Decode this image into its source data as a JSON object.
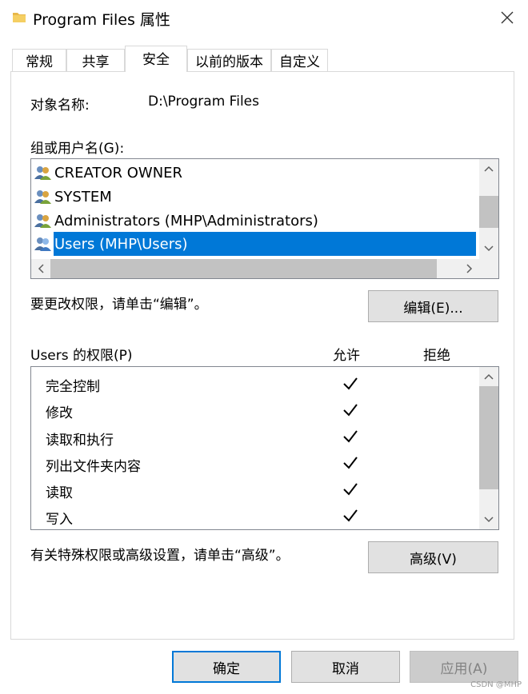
{
  "window": {
    "title": "Program Files 属性",
    "icon": "folder-icon"
  },
  "tabs": [
    {
      "label": "常规"
    },
    {
      "label": "共享"
    },
    {
      "label": "安全",
      "active": true
    },
    {
      "label": "以前的版本"
    },
    {
      "label": "自定义"
    }
  ],
  "security": {
    "object_name_label": "对象名称:",
    "object_name_value": "D:\\Program Files",
    "groups_label": "组或用户名(G):",
    "groups": [
      {
        "name": "CREATOR OWNER",
        "icon": "user-group-icon"
      },
      {
        "name": "SYSTEM",
        "icon": "user-group-icon"
      },
      {
        "name": "Administrators (MHP\\Administrators)",
        "icon": "user-group-icon"
      },
      {
        "name": "Users (MHP\\Users)",
        "icon": "user-group-icon",
        "selected": true
      }
    ],
    "edit_hint": "要更改权限，请单击“编辑”。",
    "edit_button": "编辑(E)...",
    "permissions_label": "Users 的权限(P)",
    "allow_header": "允许",
    "deny_header": "拒绝",
    "permissions": [
      {
        "name": "完全控制",
        "allow": true,
        "deny": false
      },
      {
        "name": "修改",
        "allow": true,
        "deny": false
      },
      {
        "name": "读取和执行",
        "allow": true,
        "deny": false
      },
      {
        "name": "列出文件夹内容",
        "allow": true,
        "deny": false
      },
      {
        "name": "读取",
        "allow": true,
        "deny": false
      },
      {
        "name": "写入",
        "allow": true,
        "deny": false
      }
    ],
    "advanced_hint": "有关特殊权限或高级设置，请单击“高级”。",
    "advanced_button": "高级(V)"
  },
  "footer": {
    "ok": "确定",
    "cancel": "取消",
    "apply": "应用(A)"
  },
  "watermark": "CSDN @MHP"
}
